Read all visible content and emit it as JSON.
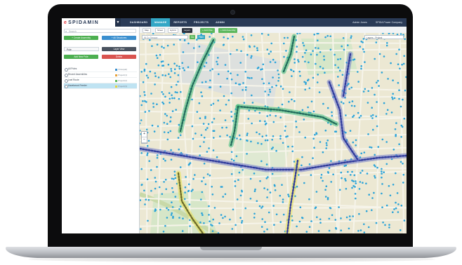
{
  "brand": {
    "name": "SPIDAMIN",
    "accent": "#e4353b"
  },
  "nav": {
    "items": [
      "DASHBOARD",
      "MANAGE",
      "REPORTS",
      "PROJECTS",
      "ADMIN"
    ],
    "active_index": 1,
    "user": "Admin Jones",
    "company": "SPIDA Power Company"
  },
  "panel": {
    "search_placeholder": "Search",
    "create_assembly_label": "+ Create Assembly",
    "all_structures_label": "+ All Structures",
    "layer_selector_label": "Pole",
    "select_dropdown_label": "Layer View",
    "add_new_label": "Add New Pole",
    "delete_label": "Delete",
    "layers": [
      {
        "label": "All Poles",
        "tag": "Poles(all)",
        "color": "#3a8fcf",
        "selected": false
      },
      {
        "label": "Recent Assemblies",
        "tag": "Project(1)",
        "color": "#e8a23a",
        "selected": false
      },
      {
        "label": "Leaf Route",
        "tag": "Project(2)",
        "color": "#5cb85c",
        "selected": false
      },
      {
        "label": "Hazelwood Feeder",
        "tag": "Project(3)",
        "color": "#e8d43a",
        "selected": true
      }
    ]
  },
  "map_toolbar": {
    "chips": [
      "Map",
      "Street",
      "Hybrid",
      "Layers",
      "+ Add Pole",
      "+ Add Assembly"
    ],
    "address_value": "W Co Terrace",
    "go_label": "Go",
    "filter_label": "Filter",
    "dropdown_label": "Layers - Project"
  },
  "colors": {
    "nav_bg": "#2a3b57",
    "active_tab": "#33a7c6",
    "pole_dot": "#29a3d9",
    "route_green": "#3dbb7c",
    "route_navy": "#2f3a9c",
    "route_yellow": "#e8e050"
  },
  "icons": {
    "search": "search-icon",
    "zoom_in": "plus-icon",
    "zoom_out": "minus-icon",
    "dropdown": "chevron-down-icon",
    "camera": "camera-icon"
  }
}
